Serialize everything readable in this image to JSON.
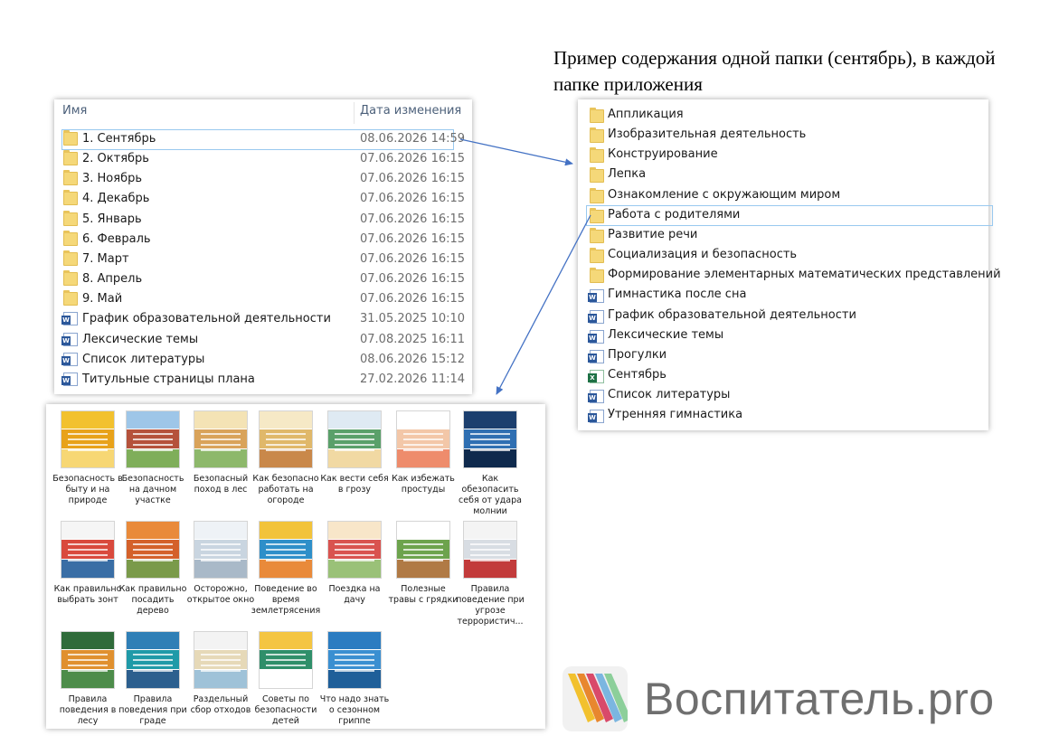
{
  "caption": {
    "line1": "Пример содержания одной папки (сентябрь), в каждой",
    "line2": "папке приложения"
  },
  "left_explorer": {
    "col_name": "Имя",
    "col_date": "Дата изменения",
    "rows": [
      {
        "name": "1. Сентябрь",
        "date": "08.06.2026 14:59",
        "icon": "folder-icon",
        "selected": true
      },
      {
        "name": "2. Октябрь",
        "date": "07.06.2026 16:15",
        "icon": "folder-icon"
      },
      {
        "name": "3. Ноябрь",
        "date": "07.06.2026 16:15",
        "icon": "folder-icon"
      },
      {
        "name": "4. Декабрь",
        "date": "07.06.2026 16:15",
        "icon": "folder-icon"
      },
      {
        "name": "5. Январь",
        "date": "07.06.2026 16:15",
        "icon": "folder-icon"
      },
      {
        "name": "6. Февраль",
        "date": "07.06.2026 16:15",
        "icon": "folder-icon"
      },
      {
        "name": "7. Март",
        "date": "07.06.2026 16:15",
        "icon": "folder-icon"
      },
      {
        "name": "8. Апрель",
        "date": "07.06.2026 16:15",
        "icon": "folder-icon"
      },
      {
        "name": "9. Май",
        "date": "07.06.2026 16:15",
        "icon": "folder-icon"
      },
      {
        "name": "График образовательной деятельности",
        "date": "31.05.2025 10:10",
        "icon": "word-doc-icon"
      },
      {
        "name": "Лексические темы",
        "date": "07.08.2025 16:11",
        "icon": "word-doc-icon"
      },
      {
        "name": "Список литературы",
        "date": "08.06.2026 15:12",
        "icon": "word-doc-icon"
      },
      {
        "name": "Титульные страницы плана",
        "date": "27.02.2026 11:14",
        "icon": "word-doc-icon"
      }
    ]
  },
  "right_explorer": {
    "rows": [
      {
        "name": "Аппликация",
        "icon": "folder-icon"
      },
      {
        "name": "Изобразительная деятельность",
        "icon": "folder-icon"
      },
      {
        "name": "Конструирование",
        "icon": "folder-icon"
      },
      {
        "name": "Лепка",
        "icon": "folder-icon"
      },
      {
        "name": "Ознакомление с окружающим миром",
        "icon": "folder-icon"
      },
      {
        "name": "Работа с родителями",
        "icon": "folder-icon",
        "selected": true
      },
      {
        "name": "Развитие речи",
        "icon": "folder-icon"
      },
      {
        "name": "Социализация и безопасность",
        "icon": "folder-icon"
      },
      {
        "name": "Формирование элементарных математических представлений",
        "icon": "folder-icon"
      },
      {
        "name": "Гимнастика после сна",
        "icon": "word-doc-icon"
      },
      {
        "name": "График образовательной деятельности",
        "icon": "word-doc-icon"
      },
      {
        "name": "Лексические темы",
        "icon": "word-doc-icon"
      },
      {
        "name": "Прогулки",
        "icon": "word-doc-icon"
      },
      {
        "name": "Сентябрь",
        "icon": "excel-doc-icon"
      },
      {
        "name": "Список литературы",
        "icon": "word-doc-icon"
      },
      {
        "name": "Утренняя гимнастика",
        "icon": "word-doc-icon"
      }
    ]
  },
  "image_grid": {
    "items": [
      {
        "label": "Безопасность в быту и на природе",
        "colors": [
          "#f2c12e",
          "#e8a21a",
          "#f7d774"
        ]
      },
      {
        "label": "Безопасность на дачном участке",
        "colors": [
          "#9ec6e8",
          "#b5523b",
          "#7fae5a"
        ]
      },
      {
        "label": "Безопасный поход в лес",
        "colors": [
          "#f4e3b5",
          "#d9a35a",
          "#8db86b"
        ]
      },
      {
        "label": "Как безопасно работать на огороде",
        "colors": [
          "#f6e9c6",
          "#e0b86a",
          "#c9884a"
        ]
      },
      {
        "label": "Как вести себя в грозу",
        "colors": [
          "#dfeaf3",
          "#5aa06a",
          "#f1d9a3"
        ]
      },
      {
        "label": "Как избежать простуды",
        "colors": [
          "#ffffff",
          "#f3c7a8",
          "#ee8c6c"
        ]
      },
      {
        "label": "Как обезопасить себя от удара молнии",
        "colors": [
          "#1c3f6e",
          "#2f6fb2",
          "#0f2a4d"
        ]
      },
      {
        "label": "Как правильно выбрать зонт",
        "colors": [
          "#f5f5f5",
          "#d94a3d",
          "#3a6ea5"
        ]
      },
      {
        "label": "Как правильно посадить дерево",
        "colors": [
          "#e98a3a",
          "#d4612a",
          "#7a9a4a"
        ]
      },
      {
        "label": "Осторожно, открытое окно",
        "colors": [
          "#eef2f6",
          "#c9d5e0",
          "#a9b9c8"
        ]
      },
      {
        "label": "Поведение во время землетрясения",
        "colors": [
          "#f2c33a",
          "#2e8fc9",
          "#e98a3a"
        ]
      },
      {
        "label": "Поездка на дачу",
        "colors": [
          "#f8e6c9",
          "#d9534f",
          "#9ac178"
        ]
      },
      {
        "label": "Полезные травы с грядки",
        "colors": [
          "#ffffff",
          "#6da34d",
          "#b07a45"
        ]
      },
      {
        "label": "Правила поведение при угрозе террористич...",
        "colors": [
          "#f4f4f4",
          "#d8dde3",
          "#c23b3b"
        ]
      },
      {
        "label": "Правила поведения в лесу",
        "colors": [
          "#2f6b3a",
          "#e0902f",
          "#4d8c4a"
        ]
      },
      {
        "label": "Правила поведения при граде",
        "colors": [
          "#2f7fb6",
          "#1f9aa8",
          "#2c5f8e"
        ]
      },
      {
        "label": "Раздельный сбор отходов",
        "colors": [
          "#f3f3f3",
          "#e6d9b8",
          "#9fc2d8"
        ]
      },
      {
        "label": "Советы по безопасности детей",
        "colors": [
          "#f4c542",
          "#2f8f6a",
          "#ffffff"
        ]
      },
      {
        "label": "Что надо знать о сезонном гриппе",
        "colors": [
          "#2b7cc1",
          "#3a8fd1",
          "#1f5f99"
        ]
      }
    ]
  },
  "logo": {
    "text": "Воспитатель.pro",
    "stripe_colors": [
      "#f2c12e",
      "#e8872e",
      "#d94a6a",
      "#7bb6e0",
      "#8ccf9a"
    ]
  }
}
